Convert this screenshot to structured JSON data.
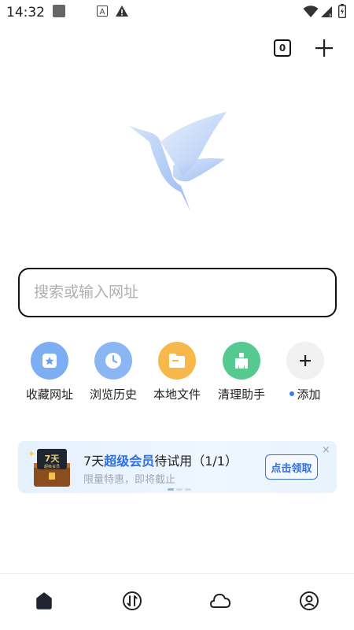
{
  "status_bar": {
    "time": "14:32",
    "icons": [
      "square-notification-icon",
      "a-box-icon",
      "warning-icon",
      "wifi-icon",
      "signal-icon",
      "battery-icon"
    ]
  },
  "header": {
    "tab_count": "0",
    "new_tab_icon": "plus-icon"
  },
  "logo": {
    "icon": "bird-logo-icon"
  },
  "search": {
    "placeholder": "搜索或输入网址",
    "value": ""
  },
  "shortcuts": [
    {
      "label": "收藏网址",
      "icon": "bookmark-star-icon",
      "color": "#6aa0ee"
    },
    {
      "label": "浏览历史",
      "icon": "clock-icon",
      "color": "#79aaf2"
    },
    {
      "label": "本地文件",
      "icon": "folder-icon",
      "color": "#f6b64a"
    },
    {
      "label": "清理助手",
      "icon": "broom-icon",
      "color": "#4fc58a"
    },
    {
      "label": "添加",
      "icon": "plus-icon",
      "color": "#f0f0f0"
    }
  ],
  "promo": {
    "title_prefix": "7天",
    "title_highlight": "超级会员",
    "title_suffix": "待试用（1/1）",
    "subtitle": "限量特惠，即将截止",
    "button": "点击领取",
    "close": "×",
    "chest_label": "7天",
    "chest_sub": "超级会员"
  },
  "bottom_nav": [
    {
      "name": "home",
      "icon": "home-icon"
    },
    {
      "name": "transfer",
      "icon": "transfer-arrows-icon"
    },
    {
      "name": "cloud",
      "icon": "cloud-icon"
    },
    {
      "name": "profile",
      "icon": "user-profile-icon"
    }
  ],
  "colors": {
    "accent": "#2f6fe4",
    "dot": "#3a7bf0"
  }
}
